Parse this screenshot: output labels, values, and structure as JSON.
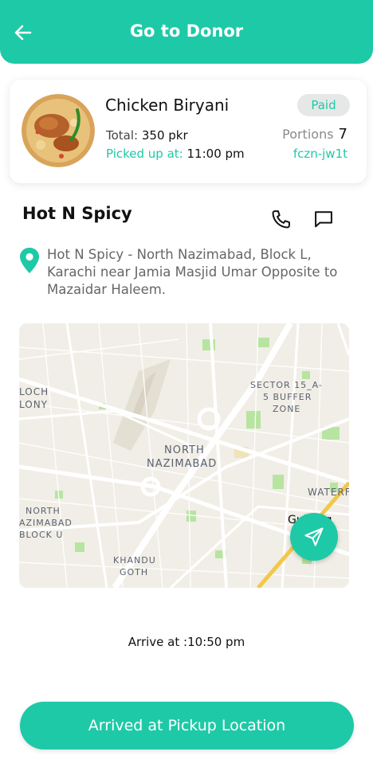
{
  "header": {
    "title": "Go to Donor",
    "back_icon": "back-arrow-icon"
  },
  "order": {
    "food_name": "Chicken Biryani",
    "total_label": "Total:",
    "total_value": "350 pkr",
    "pickup_label": "Picked up at:",
    "pickup_value": "11:00 pm",
    "status": "Paid",
    "portions_label": "Portions",
    "portions_value": "7",
    "code": "fczn-jw1t",
    "image": "chicken-biryani-photo"
  },
  "donor": {
    "name": "Hot N Spicy",
    "address": "Hot N Spicy - North Nazimabad, Block L, Karachi near Jamia Masjid Umar Opposite to Mazaidar Haleem.",
    "icons": [
      "phone-icon",
      "chat-icon",
      "location-pin-icon"
    ]
  },
  "map": {
    "labels": {
      "loch": "LOCH",
      "lony": "LONY",
      "sector1": "SECTOR 15_A-",
      "sector2": "5 BUFFER",
      "sector3": "ZONE",
      "north1": "NORTH",
      "north2": "NAZIMABAD",
      "bl1": "NORTH",
      "bl2": "AZIMABAD",
      "bl3": "BLOCK U",
      "khandu1": "KHANDU",
      "khandu2": "GOTH",
      "waterf": "WATERF",
      "gulberg": "Gulberg"
    },
    "nav_icon": "navigation-arrow-icon"
  },
  "arrival": {
    "text": "Arrive at :10:50 pm"
  },
  "cta": {
    "label": "Arrived at Pickup Location"
  },
  "colors": {
    "accent": "#1ec9a7",
    "map_bg": "#f0eee6",
    "map_road": "#ffffff",
    "map_park": "#b7e4a0",
    "highway": "#f2c84b"
  }
}
